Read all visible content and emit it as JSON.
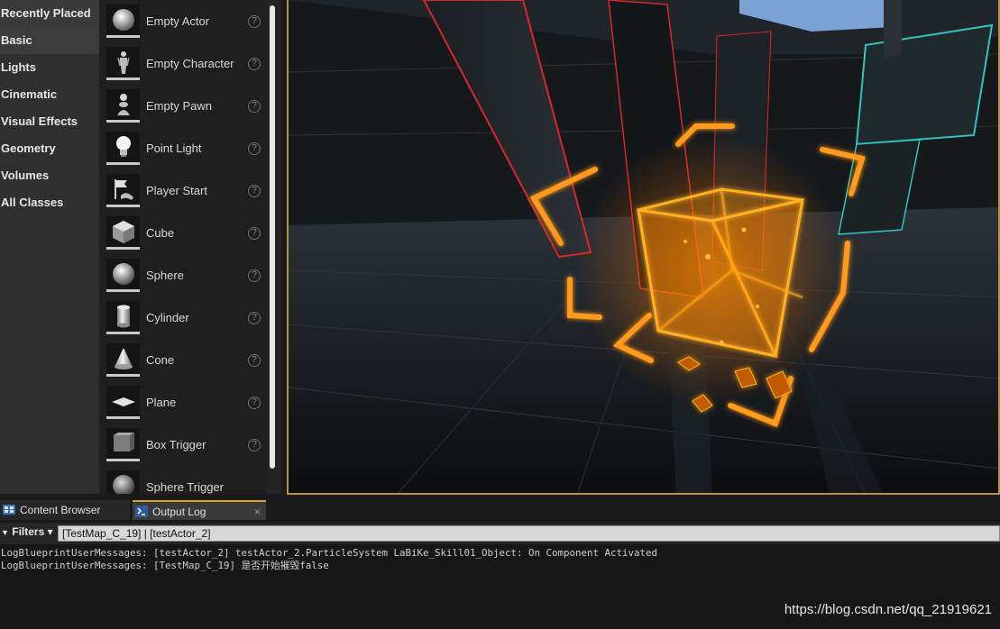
{
  "categories": [
    {
      "label": "Recently Placed",
      "active": false
    },
    {
      "label": "Basic",
      "active": true
    },
    {
      "label": "Lights",
      "active": false
    },
    {
      "label": "Cinematic",
      "active": false
    },
    {
      "label": "Visual Effects",
      "active": false
    },
    {
      "label": "Geometry",
      "active": false
    },
    {
      "label": "Volumes",
      "active": false
    },
    {
      "label": "All Classes",
      "active": false
    }
  ],
  "actors": [
    {
      "label": "Empty Actor",
      "icon": "sphere-icon"
    },
    {
      "label": "Empty Character",
      "icon": "character-icon"
    },
    {
      "label": "Empty Pawn",
      "icon": "pawn-icon"
    },
    {
      "label": "Point Light",
      "icon": "lightbulb-icon"
    },
    {
      "label": "Player Start",
      "icon": "player-start-icon"
    },
    {
      "label": "Cube",
      "icon": "cube-icon"
    },
    {
      "label": "Sphere",
      "icon": "sphere-icon"
    },
    {
      "label": "Cylinder",
      "icon": "cylinder-icon"
    },
    {
      "label": "Cone",
      "icon": "cone-icon"
    },
    {
      "label": "Plane",
      "icon": "plane-icon"
    },
    {
      "label": "Box Trigger",
      "icon": "box-trigger-icon"
    },
    {
      "label": "Sphere Trigger",
      "icon": "sphere-trigger-icon"
    }
  ],
  "help_glyph": "?",
  "tabs": {
    "content_browser": "Content Browser",
    "output_log": "Output Log",
    "close_glyph": "×"
  },
  "filter": {
    "label": "Filters",
    "caret": "▾",
    "funnel_glyph": "▼",
    "search_value": "[TestMap_C_19] | [testActor_2]"
  },
  "log": {
    "lines": [
      "LogBlueprintUserMessages: [testActor_2] testActor_2.ParticleSystem LaBiKe_Skill01_Object: On Component Activated",
      "LogBlueprintUserMessages: [TestMap_C_19] 是否开始摧毁false"
    ]
  },
  "watermark": "https://blog.csdn.net/qq_21919621",
  "colors": {
    "accent_tab": "#d8a12b",
    "viewport_border": "#b8933a",
    "effect_orange": "#ff9a1a",
    "effect_glow": "#ffd27a"
  }
}
